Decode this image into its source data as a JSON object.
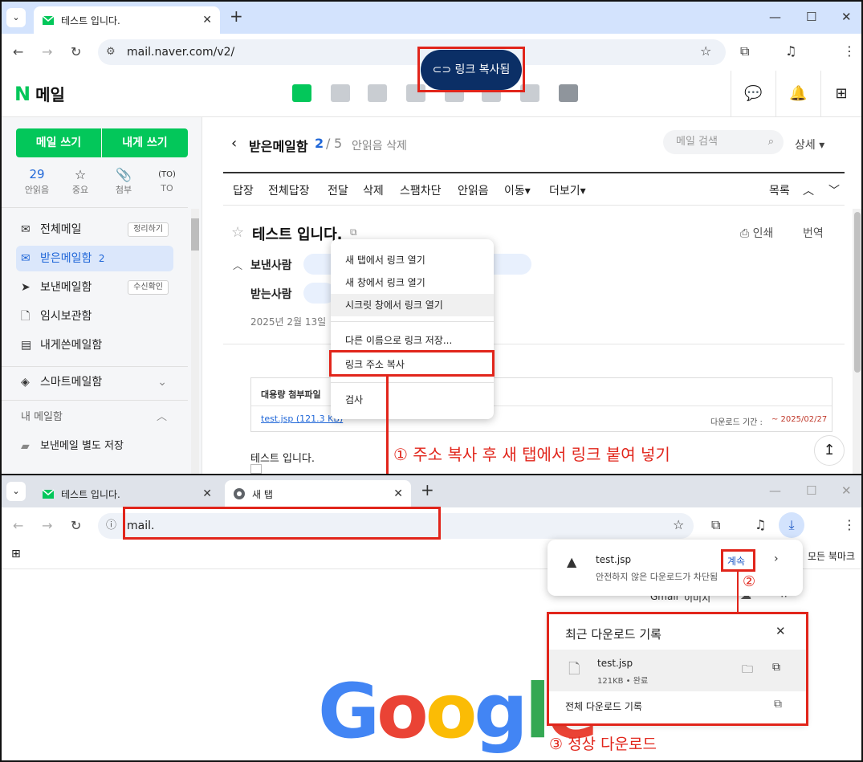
{
  "top_browser": {
    "tab_title": "테스트 입니다.",
    "url": "mail.naver.com/v2/"
  },
  "toast": {
    "label": "링크 복사됨"
  },
  "naver": {
    "logo_letter": "N",
    "logo_text": "메일",
    "write_button": "메일 쓰기",
    "write_self_button": "내게 쓰기",
    "quick": [
      {
        "count": "29",
        "label": "안읽음"
      },
      {
        "label": "중요"
      },
      {
        "label": "첨부"
      },
      {
        "label": "TO"
      }
    ],
    "sidebar": [
      {
        "label": "전체메일",
        "tag": "정리하기"
      },
      {
        "label": "받은메일함",
        "count": "2"
      },
      {
        "label": "보낸메일함",
        "tag": "수신확인"
      },
      {
        "label": "임시보관함"
      },
      {
        "label": "내게쓴메일함"
      },
      {
        "label": "스마트메일함"
      },
      {
        "label": "내 메일함"
      },
      {
        "label": "보낸메일 별도 저장"
      }
    ],
    "folder_title": "받은메일함",
    "folder_unread": "2",
    "folder_total": "5",
    "delete_unread": "안읽음 삭제",
    "search_placeholder": "메일 검색",
    "detail_label": "상세",
    "actions": [
      "답장",
      "전체답장",
      "전달",
      "삭제",
      "스팸차단",
      "안읽음",
      "이동",
      "더보기"
    ],
    "list_label": "목록",
    "subject": "테스트 입니다.",
    "print_label": "인쇄",
    "translate_label": "번역",
    "sender_label": "보낸사람",
    "receiver_label": "받는사람",
    "date_partial": "2025년 2월 13일",
    "attach_title_partial": "대용량 첨부파일",
    "attach_file": "test.jsp (121.3 KB)",
    "attach_period_label": "다운로드 기간 :",
    "attach_period_value": "~ 2025/02/27",
    "body_text": "테스트 입니다."
  },
  "context_menu": [
    "새 탭에서 링크 열기",
    "새 창에서 링크 열기",
    "시크릿 창에서 링크 열기",
    "다른 이름으로 링크 저장...",
    "링크 주소 복사",
    "검사"
  ],
  "annotations": {
    "step1": "① 주소 복사 후 새 탭에서 링크 붙여 넣기",
    "step2": "②",
    "step3": "③ 정상 다운로드"
  },
  "bottom_browser": {
    "tab1_title": "테스트 입니다.",
    "tab2_title": "새 탭",
    "url_typed": "mail.",
    "bookmarks_label": "모든 북마크",
    "google_link_gmail": "Gmail",
    "google_link_images": "이미지",
    "google_letters": [
      "G",
      "o",
      "o",
      "g",
      "l",
      "e"
    ]
  },
  "download_popup": {
    "file": "test.jsp",
    "warning": "안전하지 않은 다운로드가 차단됨",
    "continue_label": "계속"
  },
  "download_panel": {
    "title": "최근 다운로드 기록",
    "file": "test.jsp",
    "meta": "121KB • 완료",
    "all_history": "전체 다운로드 기록"
  },
  "colors": {
    "naver_green": "#03c75a",
    "annotation_red": "#e1251b",
    "toast_navy": "#0b2f66",
    "link_blue": "#2067d8",
    "google_blue": "#4285f4",
    "google_red": "#ea4335",
    "google_yellow": "#fbbc05",
    "google_green": "#34a853"
  }
}
